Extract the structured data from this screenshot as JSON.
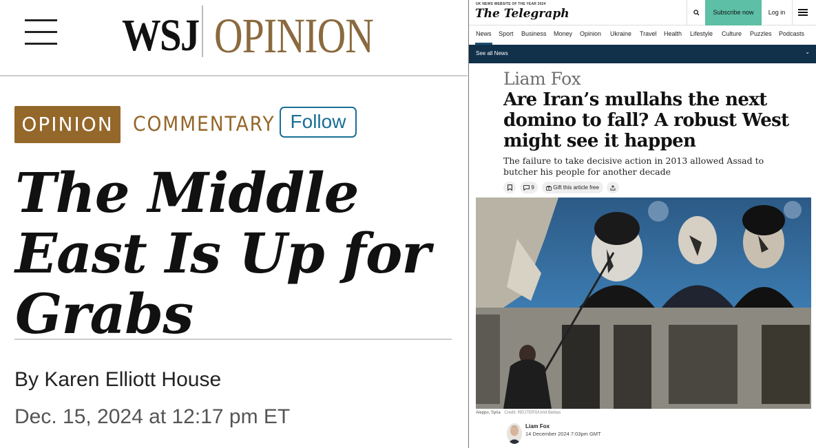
{
  "wsj": {
    "logo_left": "WSJ",
    "logo_right": "OPINION",
    "section_badge": "OPINION",
    "category": "COMMENTARY",
    "follow_label": "Follow",
    "headline": "The Middle East Is Up for Grabs",
    "byline": "By Karen Elliott House",
    "date": "Dec. 15, 2024 at 12:17 pm ET",
    "colors": {
      "accent": "#94672a",
      "follow": "#1a6e96"
    },
    "icons": {
      "menu": "hamburger-icon"
    }
  },
  "telegraph": {
    "tagline": "UK NEWS WEBSITE OF THE YEAR 2024",
    "masthead": "The Telegraph",
    "subscribe_label": "Subscribe now",
    "login_label": "Log in",
    "nav": [
      "News",
      "Sport",
      "Business",
      "Money",
      "Opinion",
      "Ukraine",
      "Travel",
      "Health",
      "Lifestyle",
      "Culture",
      "Puzzles",
      "Podcasts"
    ],
    "see_all": "See all News",
    "author": "Liam Fox",
    "title": "Are Iran’s mullahs the next domino to fall? A robust West might see it happen",
    "standfirst": "The failure to take decisive action in 2013 allowed Assad to butcher his people for another decade",
    "comments_count": "9",
    "gift_label": "Gift this article free",
    "caption_location": "Aleppo, Syria",
    "caption_credit": "Credit: REUTERS/Umit Bektas",
    "byline_name": "Liam Fox",
    "byline_date": "14 December 2024 7:03pm GMT",
    "colors": {
      "subscribe": "#5dbfa5",
      "subnav": "#11304a",
      "underline": "#1b4f6e"
    },
    "icons": {
      "search": "search-icon",
      "menu": "hamburger-icon",
      "bookmark": "bookmark-icon",
      "comments": "comment-icon",
      "gift": "gift-icon",
      "share": "share-icon"
    }
  }
}
